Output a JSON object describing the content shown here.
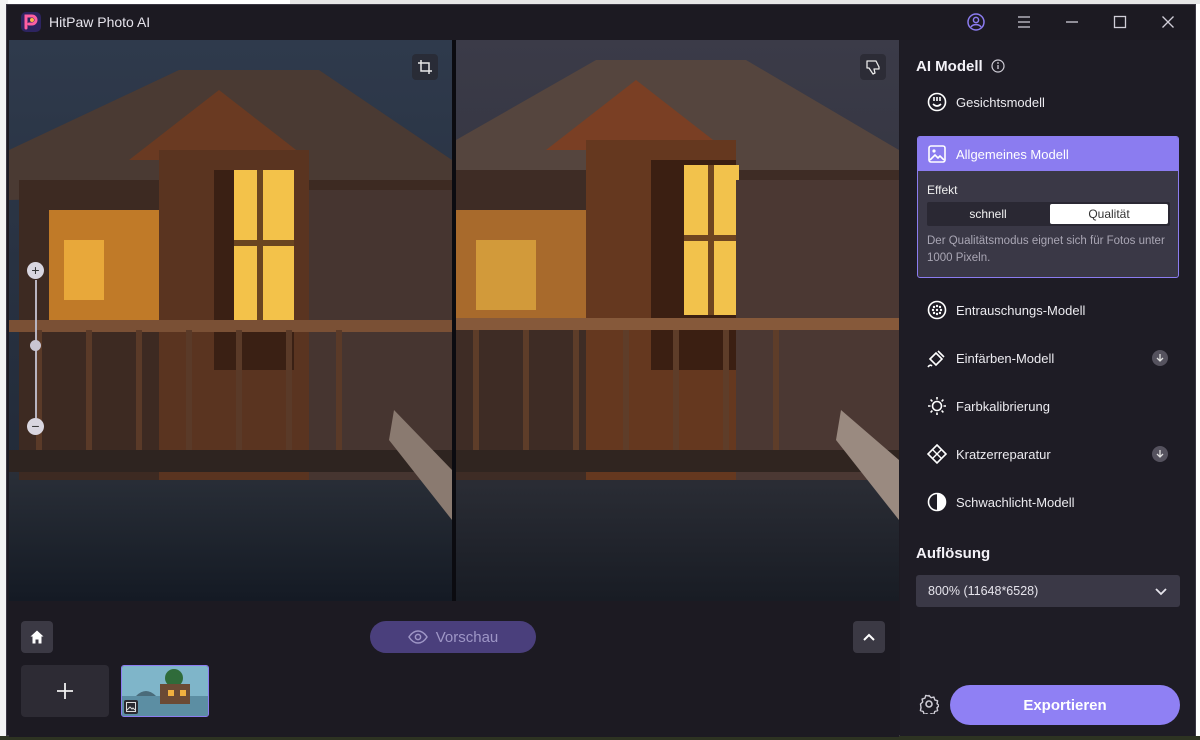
{
  "app": {
    "title": "HitPaw Photo AI"
  },
  "toolbar": {
    "preview_label": "Vorschau"
  },
  "panel": {
    "ai_model_title": "AI Modell",
    "models": [
      {
        "label": "Gesichtsmodell",
        "icon": "face-icon"
      },
      {
        "label": "Allgemeines Modell",
        "icon": "image-icon",
        "selected": true
      },
      {
        "label": "Entrauschungs-Modell",
        "icon": "denoise-icon"
      },
      {
        "label": "Einfärben-Modell",
        "icon": "colorize-icon",
        "download": true
      },
      {
        "label": "Farbkalibrierung",
        "icon": "sun-icon"
      },
      {
        "label": "Kratzerreparatur",
        "icon": "scratch-repair-icon",
        "download": true
      },
      {
        "label": "Schwachlicht-Modell",
        "icon": "low-light-icon"
      }
    ],
    "effect": {
      "label": "Effekt",
      "options": [
        "schnell",
        "Qualität"
      ],
      "selected": "Qualität",
      "hint": "Der Qualitätsmodus eignet sich für Fotos unter 1000 Pixeln."
    },
    "resolution_title": "Auflösung",
    "resolution_value": "800% (11648*6528)",
    "export_label": "Exportieren"
  },
  "colors": {
    "accent": "#8b7cf0",
    "background": "#1c1a22",
    "panel": "#1e1c25"
  }
}
